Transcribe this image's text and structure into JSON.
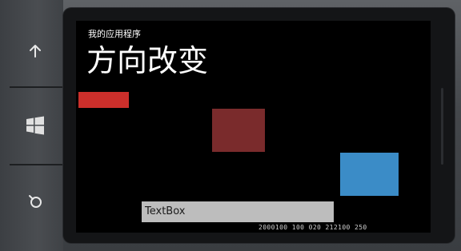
{
  "app": {
    "title": "我的应用程序",
    "page_title": "方向改变"
  },
  "textbox": {
    "value": "TextBox"
  },
  "frame_counter": {
    "text": "2000100 100 020 212100 250"
  },
  "hardware_buttons": {
    "back": "back-arrow-icon",
    "start": "windows-logo-icon",
    "search": "search-icon"
  },
  "colors": {
    "rect_red": "#cc2f2b",
    "rect_dark": "#7a2b2c",
    "rect_blue": "#3b8cc7",
    "textbox_bg": "#bdbdbd",
    "screen_bg": "#000000"
  }
}
